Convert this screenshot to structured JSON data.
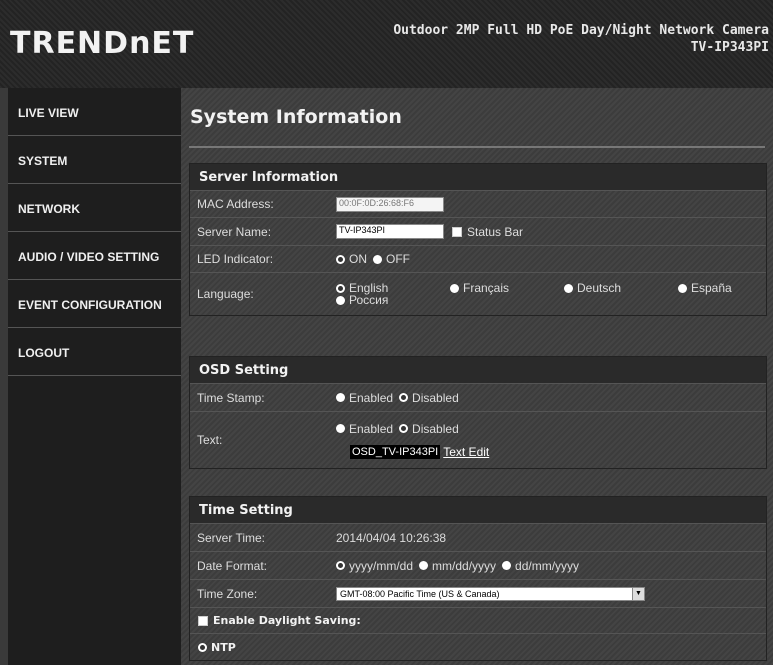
{
  "header": {
    "logo": "TRENDnET",
    "model_line1": "Outdoor 2MP Full HD PoE Day/Night Network Camera",
    "model_line2": "TV-IP343PI"
  },
  "sidebar": {
    "items": [
      {
        "label": "LIVE VIEW"
      },
      {
        "label": "SYSTEM"
      },
      {
        "label": "NETWORK"
      },
      {
        "label": "AUDIO / VIDEO SETTING"
      },
      {
        "label": "EVENT CONFIGURATION"
      },
      {
        "label": "LOGOUT"
      }
    ]
  },
  "main": {
    "title": "System Information",
    "server": {
      "heading": "Server Information",
      "mac_label": "MAC Address:",
      "mac_value": "00:0F:0D:26:68:F6",
      "name_label": "Server Name:",
      "name_value": "TV-IP343PI",
      "status_bar_label": "Status Bar",
      "led_label": "LED Indicator:",
      "led_on": "ON",
      "led_off": "OFF",
      "lang_label": "Language:",
      "lang_options": [
        "English",
        "Français",
        "Deutsch",
        "España",
        "Россия"
      ]
    },
    "osd": {
      "heading": "OSD Setting",
      "timestamp_label": "Time Stamp:",
      "text_label": "Text:",
      "enabled": "Enabled",
      "disabled": "Disabled",
      "osd_text": "OSD_TV-IP343PI",
      "text_edit": "Text Edit"
    },
    "time": {
      "heading": "Time Setting",
      "server_time_label": "Server Time:",
      "server_time_value": "2014/04/04 10:26:38",
      "date_format_label": "Date Format:",
      "date_formats": [
        "yyyy/mm/dd",
        "mm/dd/yyyy",
        "dd/mm/yyyy"
      ],
      "timezone_label": "Time Zone:",
      "timezone_value": "GMT-08:00 Pacific Time (US & Canada)",
      "daylight_label": "Enable Daylight Saving:",
      "ntp_label": "NTP"
    }
  }
}
